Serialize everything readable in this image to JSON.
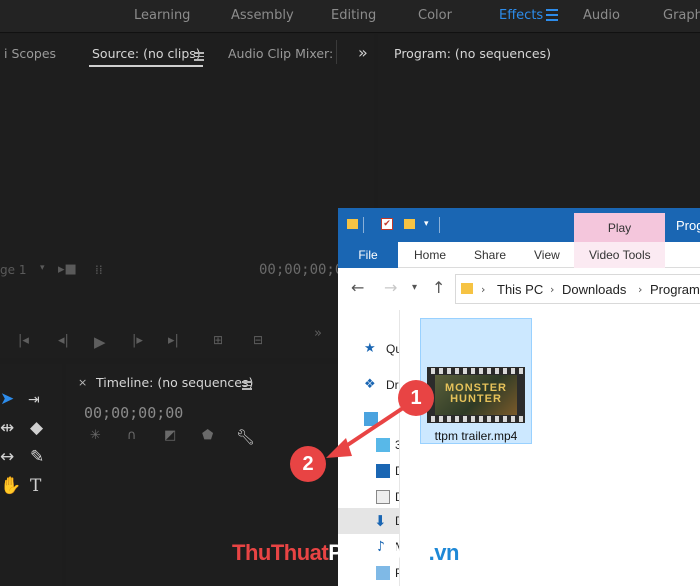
{
  "workspaces": [
    "Learning",
    "Assembly",
    "Editing",
    "Color",
    "Effects",
    "Audio",
    "Graphi"
  ],
  "active_workspace": "Effects",
  "source_panel": {
    "tabs": [
      "i Scopes",
      "Source: (no clips)",
      "Audio Clip Mixer:"
    ],
    "overflow": "»",
    "page_select": "ge 1",
    "timecode": "00;00;00;0"
  },
  "program_panel": {
    "tab": "Program: (no sequences)"
  },
  "timeline_panel": {
    "tab": "Timeline: (no sequences)",
    "timecode": "00;00;00;00"
  },
  "explorer": {
    "contextual_tab": "Play",
    "contextual_group": "Prog",
    "ribbon_tabs": [
      "File",
      "Home",
      "Share",
      "View",
      "Video Tools"
    ],
    "path": [
      "This PC",
      "Downloads",
      "Program"
    ],
    "nav_labels": [
      "Qu",
      "Dr",
      "3",
      "D",
      "D",
      "D",
      "M",
      "P"
    ],
    "file": {
      "name": "ttpm trailer.mp4",
      "thumb_title_1": "MONSTER",
      "thumb_title_2": "HUNTER"
    }
  },
  "markers": [
    "1",
    "2"
  ],
  "watermark": {
    "part1": "ThuThuat",
    "part2": "PhanMem",
    "part3": ".vn"
  },
  "colors": {
    "accent": "#2d8ceb",
    "marker": "#e84444",
    "explorer_blue": "#1a66b3",
    "play_tab": "#f4c6dc"
  }
}
